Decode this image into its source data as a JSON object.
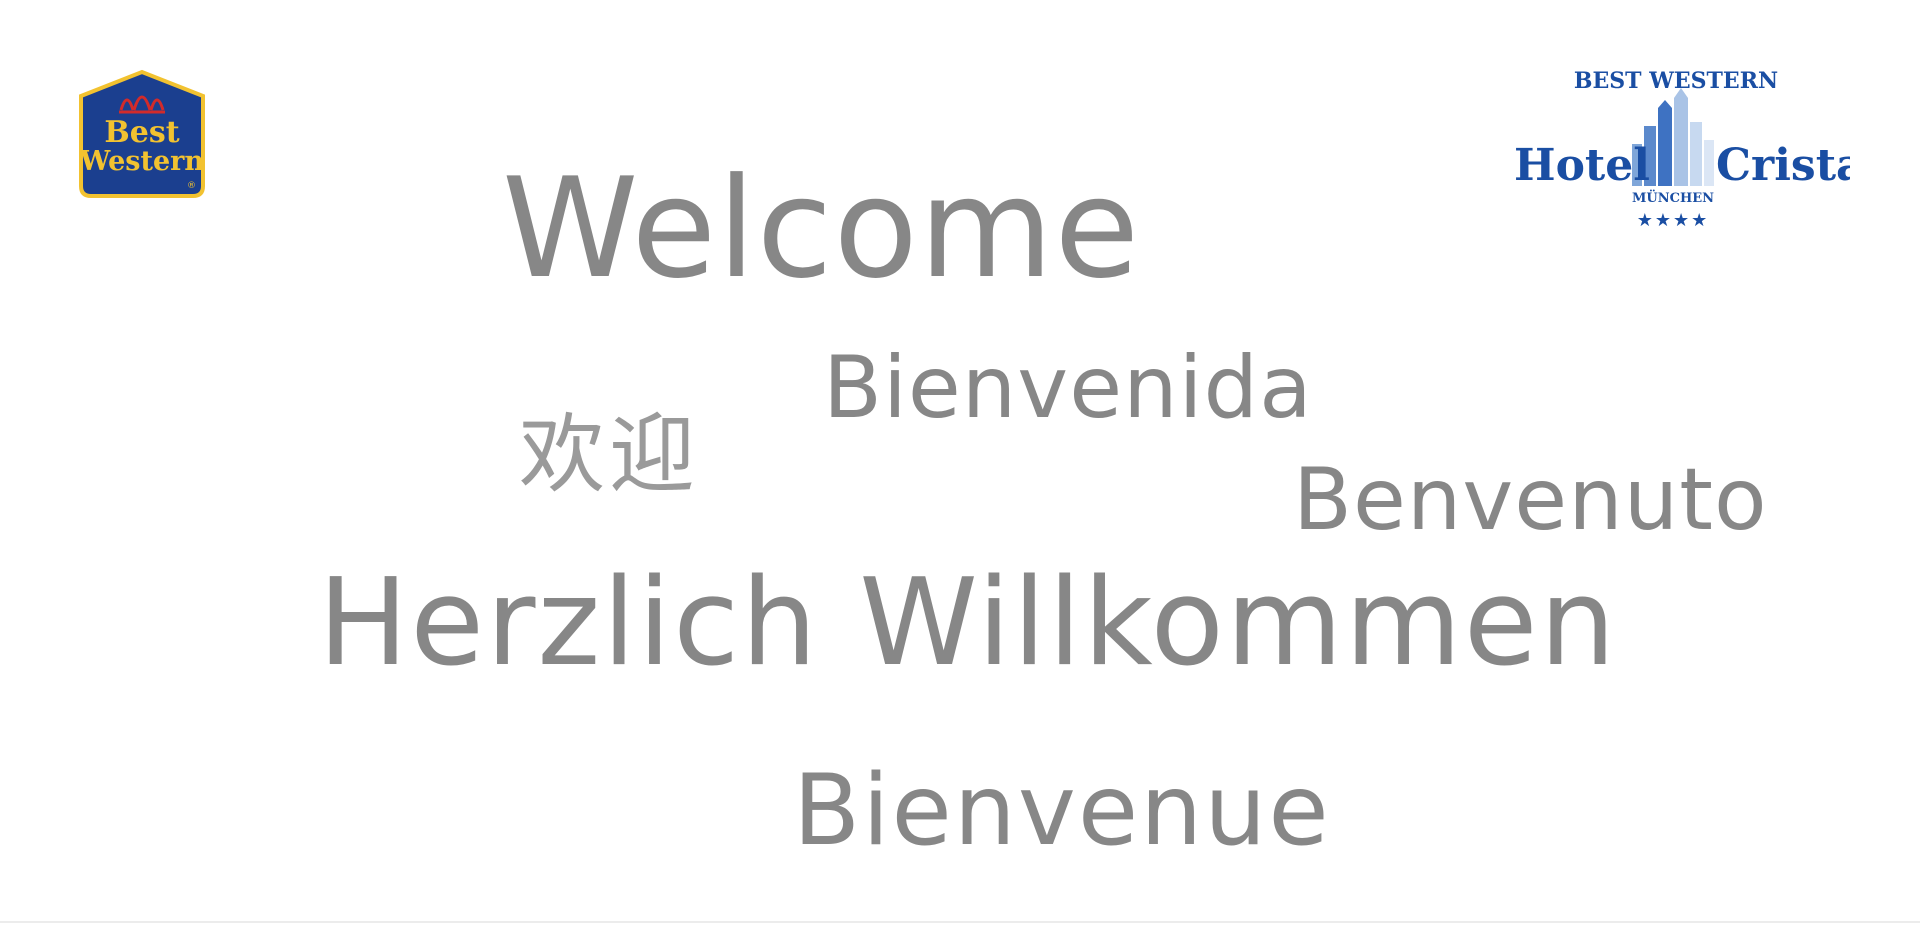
{
  "logos": {
    "left": {
      "line1": "Best",
      "line2": "Western",
      "registered": "®"
    },
    "right": {
      "brand": "BEST WESTERN",
      "name_left": "Hotel",
      "name_right": "Cristal",
      "city": "MÜNCHEN",
      "stars": "★★★★"
    }
  },
  "greetings": {
    "welcome": "Welcome",
    "bienvenida": "Bienvenida",
    "chinese": "欢迎",
    "benvenuto": "Benvenuto",
    "herzlich": "Herzlich Willkommen",
    "bienvenue": "Bienvenue"
  },
  "colors": {
    "text_gray": "#878787",
    "brand_navy": "#1b3f8f",
    "brand_gold": "#f2c230",
    "brand_red": "#d22b2b",
    "brand_blue": "#1a4ea3",
    "building_light": "#a9c3e6"
  }
}
